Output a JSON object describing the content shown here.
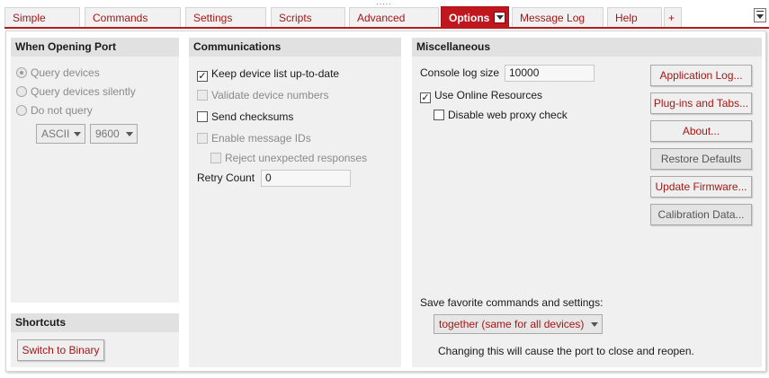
{
  "tabs": {
    "simple": "Simple",
    "commands": "Commands",
    "settings": "Settings",
    "scripts": "Scripts",
    "advanced": "Advanced",
    "options": "Options",
    "message_log": "Message Log",
    "help": "Help",
    "add": "+"
  },
  "colors": {
    "accent": "#c0171e",
    "link": "#a31818",
    "panel": "#f0f0f0",
    "panel_header": "#e1e1e1"
  },
  "opening_port": {
    "title": "When Opening Port",
    "query_devices": "Query devices",
    "query_silently": "Query devices silently",
    "do_not_query": "Do not query",
    "selected": "Query devices",
    "protocol": "ASCII",
    "baud": "9600"
  },
  "shortcuts": {
    "title": "Shortcuts",
    "switch_binary": "Switch to Binary"
  },
  "communications": {
    "title": "Communications",
    "keep_list": "Keep device list up-to-date",
    "keep_list_checked": true,
    "validate": "Validate device numbers",
    "send_checksums": "Send checksums",
    "enable_ids": "Enable message IDs",
    "reject": "Reject unexpected responses",
    "retry_label": "Retry Count",
    "retry_value": "0"
  },
  "misc": {
    "title": "Miscellaneous",
    "console_label": "Console log size",
    "console_value": "10000",
    "online": "Use Online Resources",
    "online_checked": true,
    "disable_proxy": "Disable web proxy check",
    "app_log": "Application Log...",
    "plugins": "Plug-ins and Tabs...",
    "about": "About...",
    "restore": "Restore Defaults",
    "firmware": "Update Firmware...",
    "calibration": "Calibration Data...",
    "save_label": "Save favorite commands and settings:",
    "save_option": "together (same for all devices)",
    "save_note": "Changing this will cause the port to close and reopen."
  }
}
